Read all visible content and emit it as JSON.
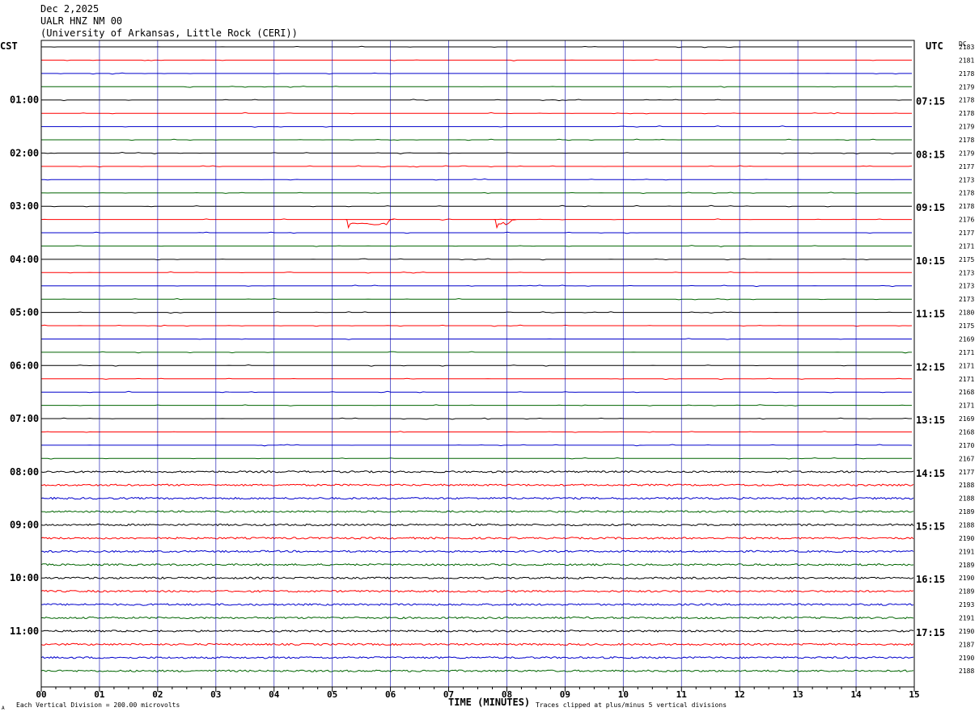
{
  "header": {
    "date": "Dec 2,2025",
    "station": "UALR HNZ NM 00",
    "institution": "(University of Arkansas, Little Rock (CERI))"
  },
  "labels": {
    "left_tz": "CST",
    "right_tz": "UTC",
    "dc": "DC",
    "xlabel": "TIME (MINUTES)",
    "footer_left": "Each Vertical Division =  200.00 microvolts",
    "footer_right": "Traces clipped at plus/minus 5 vertical divisions",
    "footer_mark": "A"
  },
  "colors": {
    "cycle": [
      "#000000",
      "#ff0000",
      "#0000cc",
      "#006400"
    ],
    "grid": "#0000aa",
    "ink": "#000000"
  },
  "chart_data": {
    "type": "line",
    "title": "Dec 2,2025 UALR HNZ NM 00 (University of Arkansas, Little Rock (CERI))",
    "xlabel": "TIME (MINUTES)",
    "x_ticks": [
      "00",
      "01",
      "02",
      "03",
      "04",
      "05",
      "06",
      "07",
      "08",
      "09",
      "10",
      "11",
      "12",
      "13",
      "14",
      "15"
    ],
    "xlim": [
      0,
      15
    ],
    "trace_minutes": 15,
    "grid": true,
    "left_hour_labels": [
      "01:00",
      "02:00",
      "03:00",
      "04:00",
      "05:00",
      "06:00",
      "07:00",
      "08:00",
      "09:00",
      "10:00",
      "11:00"
    ],
    "right_hour_labels": [
      "07:15",
      "08:15",
      "09:15",
      "10:15",
      "11:15",
      "12:15",
      "13:15",
      "14:15",
      "15:15",
      "16:15",
      "17:15"
    ],
    "dc_values": [
      2183,
      2181,
      2178,
      2179,
      2178,
      2178,
      2179,
      2178,
      2179,
      2177,
      2173,
      2178,
      2178,
      2176,
      2177,
      2171,
      2175,
      2173,
      2173,
      2173,
      2180,
      2175,
      2169,
      2171,
      2171,
      2171,
      2168,
      2171,
      2169,
      2168,
      2170,
      2167,
      2177,
      2188,
      2188,
      2189,
      2188,
      2190,
      2191,
      2189,
      2190,
      2189,
      2193,
      2191,
      2190,
      2187,
      2190,
      2188
    ],
    "events": [
      {
        "trace": 13,
        "start_min": 5.25,
        "end_min": 6.0
      },
      {
        "trace": 13,
        "start_min": 7.8,
        "end_min": 8.1
      }
    ]
  }
}
